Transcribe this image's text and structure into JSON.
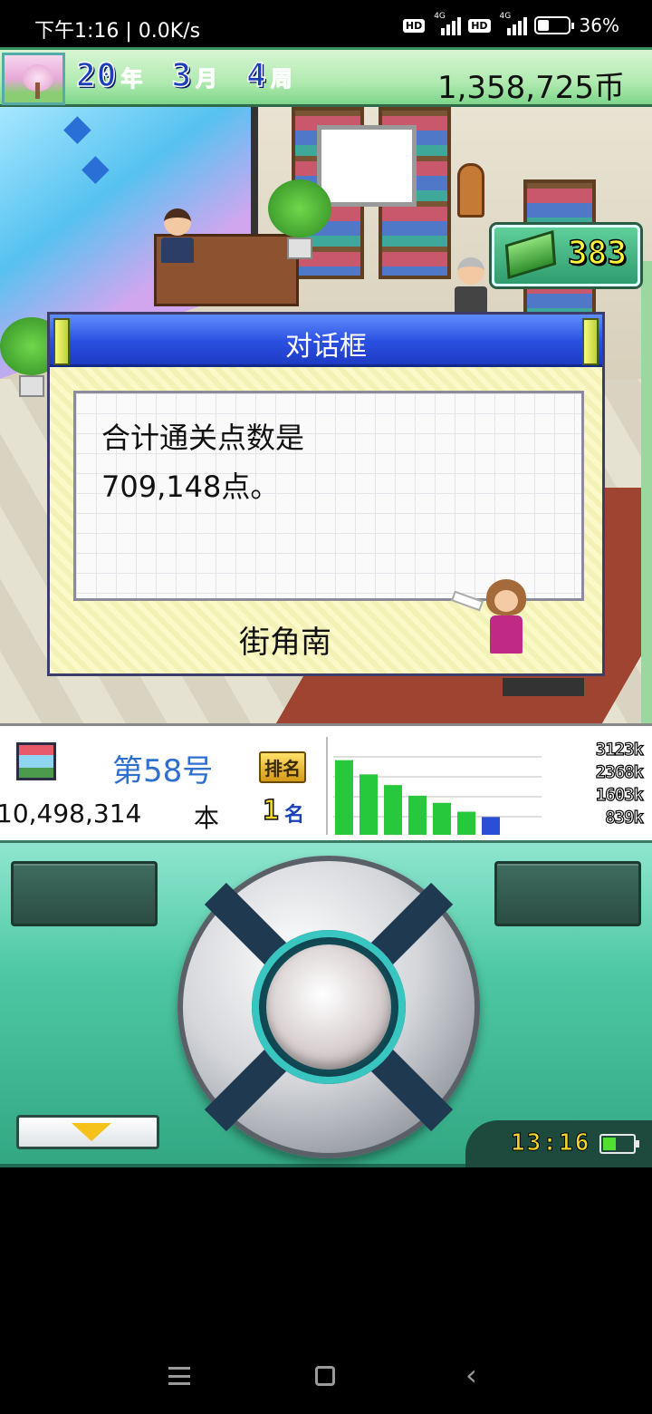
{
  "status_bar": {
    "time": "下午1:16 | 0.0K/s",
    "network": "4G",
    "battery": "36%"
  },
  "top_bar": {
    "year_num": "20",
    "year_unit": "年",
    "month_num": "3",
    "month_unit": "月",
    "week_num": "4",
    "week_unit": "周",
    "money": "1,358,725币"
  },
  "book_badge": {
    "count": "383"
  },
  "dialog": {
    "title": "对话框",
    "text": "合计通关点数是\n709,148点。",
    "speaker": "街角南"
  },
  "info_panel": {
    "issue": "第58号",
    "sales": "10,498,314",
    "sales_unit": "本",
    "rank_label": "排名",
    "rank": "1",
    "rank_unit": "名",
    "legend": [
      "3123k",
      "2368k",
      "1603k",
      "839k"
    ]
  },
  "chart_data": {
    "type": "bar",
    "values": [
      84,
      68,
      56,
      44,
      36,
      26,
      20
    ],
    "highlight_index": 6,
    "colors": {
      "bar": "#28c83c",
      "highlight": "#2a4fd6",
      "grid": "#bfbfbf"
    }
  },
  "controller": {
    "clock": "13:16"
  },
  "colors": {
    "dialog_title_bg": "#2a4fe0",
    "issue_text": "#2f6fd0",
    "controller_bg": "#4ec8a4"
  }
}
